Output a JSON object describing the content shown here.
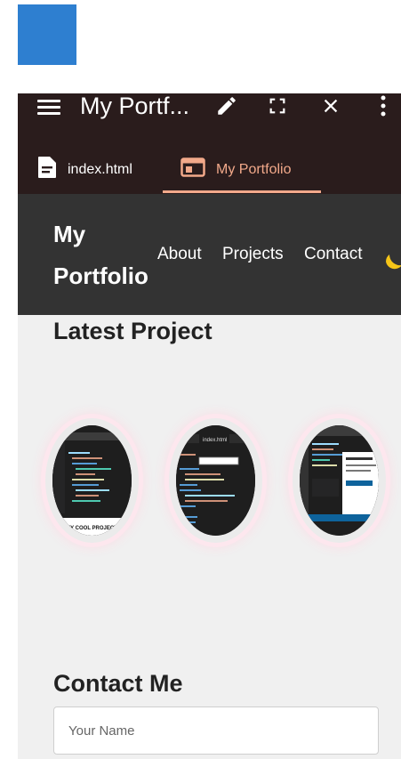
{
  "window": {
    "title": "My Portf..."
  },
  "tabs": [
    {
      "label": "index.html",
      "icon": "document-icon"
    },
    {
      "label": "My Portfolio",
      "icon": "browser-window-icon",
      "active": true
    }
  ],
  "site": {
    "brand_line1": "My",
    "brand_line2": "Portfolio",
    "nav": [
      "About",
      "Projects",
      "Contact"
    ]
  },
  "sections": {
    "latest_title": "Latest Project",
    "contact_title": "Contact Me"
  },
  "projects": [
    {
      "thumb_caption": "MY COOL PROJECT"
    },
    {
      "thumb_caption": "index.html"
    },
    {
      "thumb_caption": ""
    }
  ],
  "form": {
    "name_placeholder": "Your Name",
    "name_value": ""
  },
  "colors": {
    "accent": "#f2a98a",
    "topbar": "#2a1c1c",
    "site_nav": "#333333",
    "tile_glow": "#fde7ee",
    "top_square": "#2e7fd0"
  }
}
